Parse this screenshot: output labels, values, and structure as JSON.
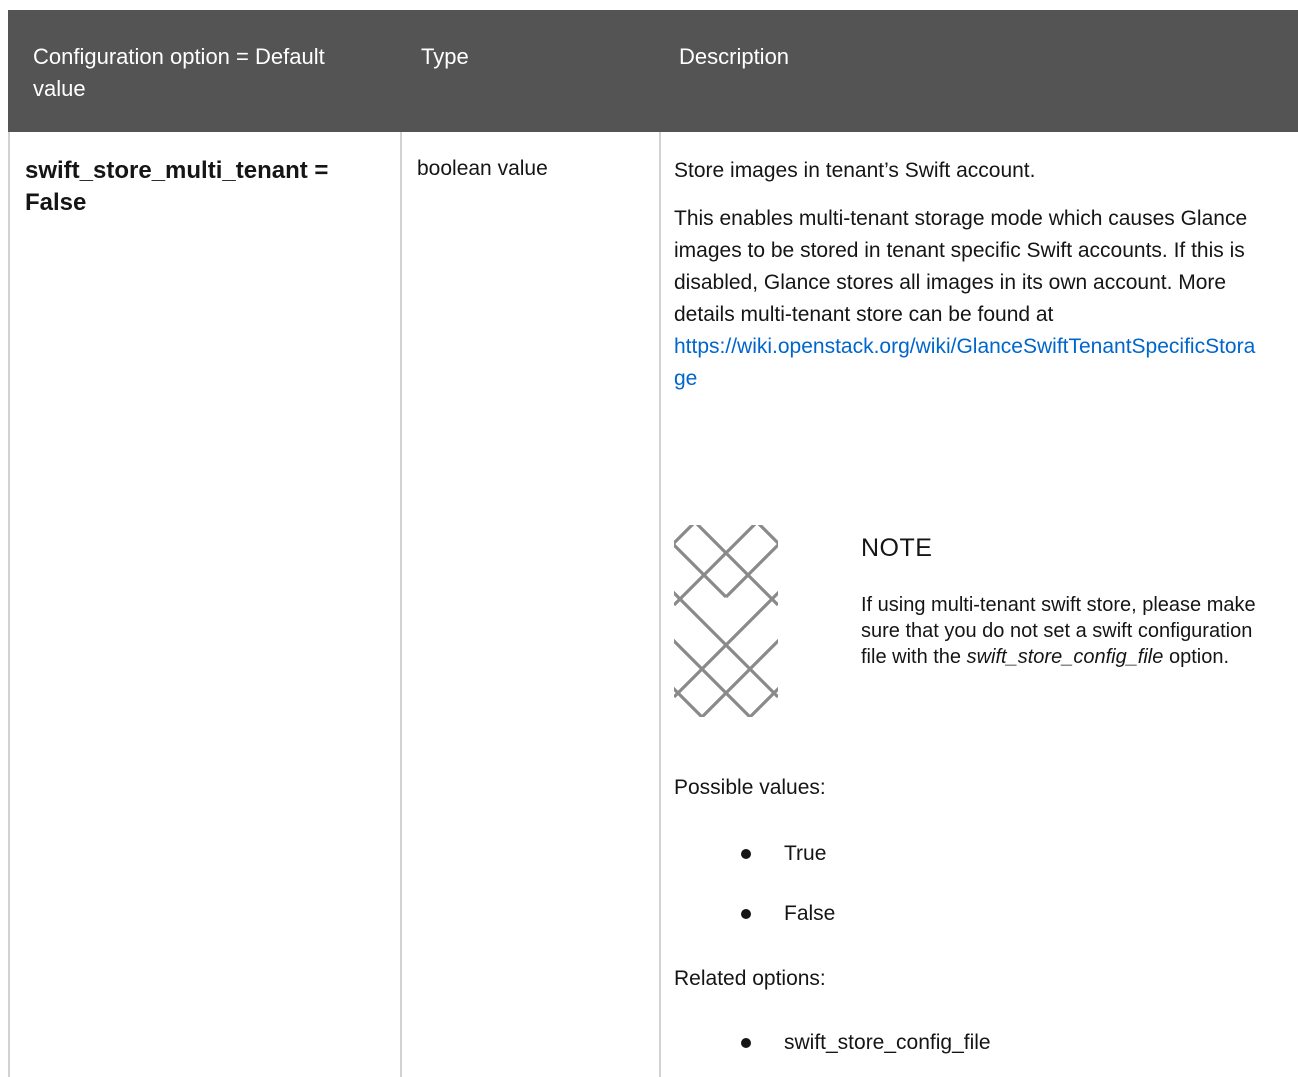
{
  "header": {
    "option_label": "Configuration option = Default value",
    "type_label": "Type",
    "description_label": "Description"
  },
  "row": {
    "option": "swift_store_multi_tenant = False",
    "type": "boolean value",
    "summary": "Store images in tenant’s Swift account.",
    "detail": "This enables multi-tenant storage mode which causes Glance images to be stored in tenant specific Swift accounts. If this is disabled, Glance stores all images in its own account. More details multi-tenant store can be found at",
    "link": "https://wiki.openstack.org/wiki/GlanceSwiftTenantSpecificStorage",
    "note": {
      "title": "NOTE",
      "text_before": "If using multi-tenant swift store, please make sure that you do not set a swift configuration file with the ",
      "emphasis": "swift_store_config_file",
      "text_after": " option."
    },
    "possible_values_label": "Possible values:",
    "possible_values": [
      "True",
      "False"
    ],
    "related_options_label": "Related options:",
    "related_options": [
      "swift_store_config_file"
    ]
  },
  "colors": {
    "header_bg": "#545454",
    "link": "#0066cc",
    "divider": "#d2d2d2"
  }
}
